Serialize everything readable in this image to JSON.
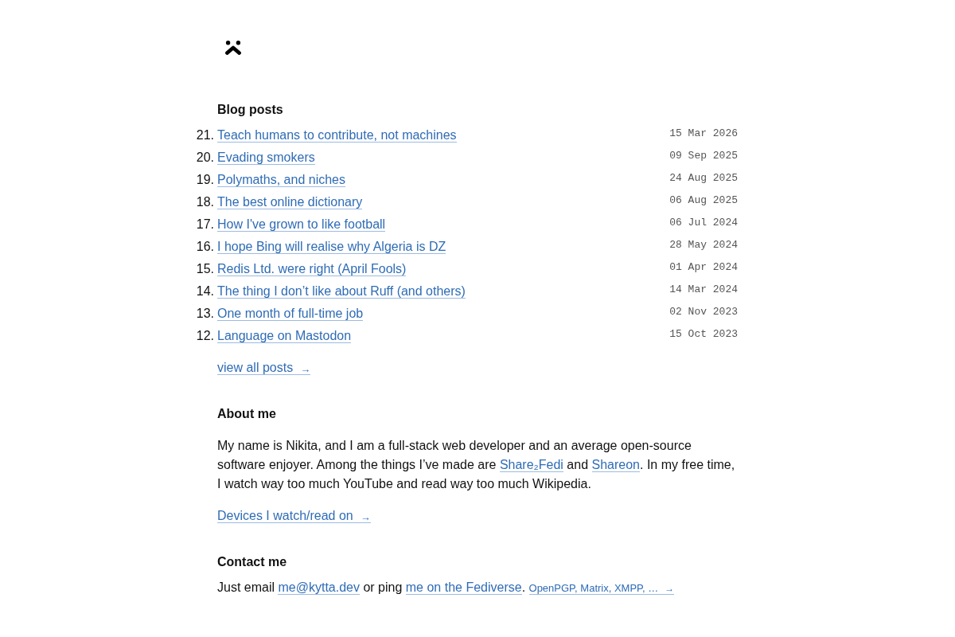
{
  "blog_posts": {
    "heading": "Blog posts",
    "posts": [
      {
        "number": "21.",
        "title": "Teach humans to contribute, not machines",
        "date": "15 Mar 2026"
      },
      {
        "number": "20.",
        "title": "Evading smokers",
        "date": "09 Sep 2025"
      },
      {
        "number": "19.",
        "title": "Polymaths, and niches",
        "date": "24 Aug 2025"
      },
      {
        "number": "18.",
        "title": "The best online dictionary",
        "date": "06 Aug 2025"
      },
      {
        "number": "17.",
        "title": "How I've grown to like football",
        "date": "06 Jul 2024"
      },
      {
        "number": "16.",
        "title": "I hope Bing will realise why Algeria is DZ",
        "date": "28 May 2024"
      },
      {
        "number": "15.",
        "title": "Redis Ltd. were right (April Fools)",
        "date": "01 Apr 2024"
      },
      {
        "number": "14.",
        "title": "The thing I don’t like about Ruff (and others)",
        "date": "14 Mar 2024"
      },
      {
        "number": "13.",
        "title": "One month of full-time job",
        "date": "02 Nov 2023"
      },
      {
        "number": "12.",
        "title": "Language on Mastodon",
        "date": "15 Oct 2023"
      }
    ],
    "view_all": {
      "label": "view all posts",
      "arrow": "→"
    }
  },
  "about_me": {
    "heading": "About me",
    "paragraph": [
      {
        "kind": "text",
        "text": "My name is Nikita, and I am a full-stack web developer and an average open-source software enjoyer. Among the things I’ve made are "
      },
      {
        "kind": "link",
        "text": "Share₂Fedi"
      },
      {
        "kind": "text",
        "text": " and "
      },
      {
        "kind": "link",
        "text": "Shareon"
      },
      {
        "kind": "text",
        "text": ". In my free time, I watch way too much YouTube and read way too much Wikipedia."
      }
    ],
    "more_link": {
      "label": "Devices I watch/read on",
      "arrow": "→"
    }
  },
  "contact_me": {
    "heading": "Contact me",
    "line": [
      {
        "kind": "text",
        "text": "Just email "
      },
      {
        "kind": "link",
        "text": "me@kytta.dev"
      },
      {
        "kind": "text",
        "text": " or ping "
      },
      {
        "kind": "link",
        "text": "me on the Fediverse"
      },
      {
        "kind": "text",
        "text": ". "
      },
      {
        "kind": "small_link",
        "text": "OpenPGP, Matrix, XMPP, …",
        "arrow": "→"
      }
    ]
  }
}
